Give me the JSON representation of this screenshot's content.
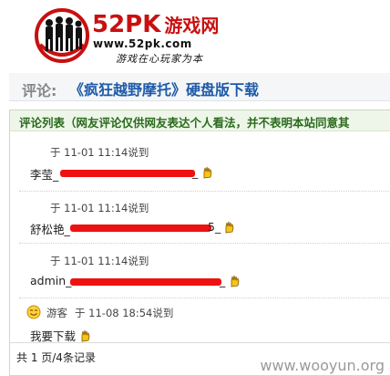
{
  "logo": {
    "title": "52PK",
    "title_cn": "游戏网",
    "url": "www.52pk.com",
    "slogan": "游戏在心玩家为本"
  },
  "page_title": {
    "prefix": "评论:",
    "game": "《疯狂越野摩托》硬盘版下载"
  },
  "comments_header": "评论列表（网友评论仅供网友表达个人看法，并不表明本站同意其",
  "comments": [
    {
      "meta": "于 11-01 11:14说到",
      "text": "李莹_",
      "tail": "_"
    },
    {
      "meta": "于 11-01 11:14说到",
      "text": "舒松艳_",
      "tail": "5_"
    },
    {
      "meta": "于 11-01 11:14说到",
      "text": "admin_",
      "tail": "_"
    },
    {
      "author": "游客",
      "meta": "于 11-08 18:54说到",
      "text": "我要下载"
    }
  ],
  "pagination": "共 1 页/4条记录",
  "watermark": "www.wooyun.org",
  "colors": {
    "brand_red": "#c81010",
    "link_blue": "#1e5aa8",
    "header_green": "#2a6a1c",
    "redaction": "#ee1111"
  }
}
